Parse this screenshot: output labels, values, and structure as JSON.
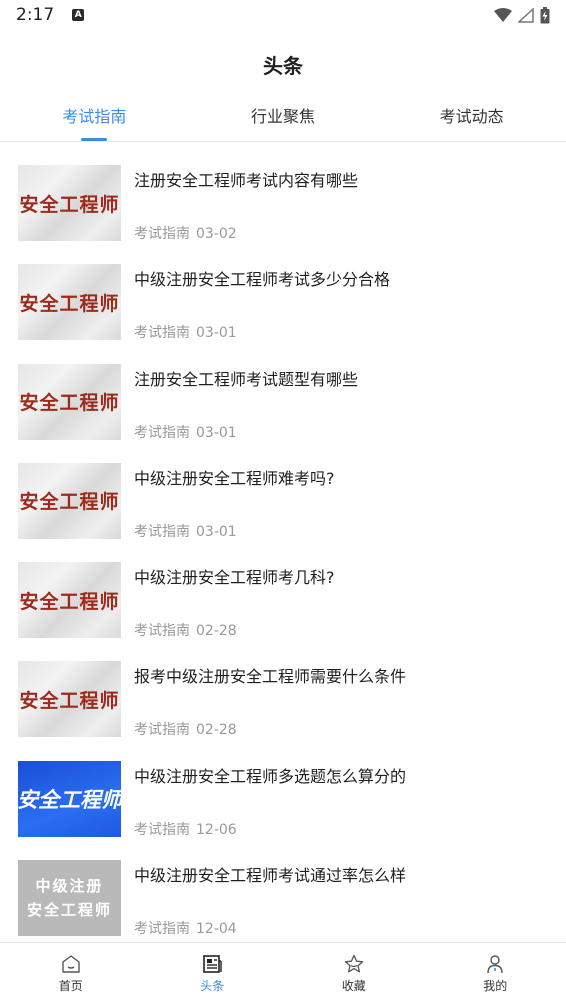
{
  "status_bar": {
    "time": "2:17",
    "icons": [
      "a-notification-icon",
      "wifi-icon",
      "signal-icon",
      "battery-icon"
    ]
  },
  "header": {
    "title": "头条"
  },
  "tabs": [
    {
      "label": "考试指南",
      "active": true
    },
    {
      "label": "行业聚焦",
      "active": false
    },
    {
      "label": "考试动态",
      "active": false
    }
  ],
  "news": [
    {
      "title": "注册安全工程师考试内容有哪些",
      "category": "考试指南",
      "date": "03-02",
      "thumb_style": "paper",
      "thumb_text": "安全工程师"
    },
    {
      "title": "中级注册安全工程师考试多少分合格",
      "category": "考试指南",
      "date": "03-01",
      "thumb_style": "paper",
      "thumb_text": "安全工程师"
    },
    {
      "title": "注册安全工程师考试题型有哪些",
      "category": "考试指南",
      "date": "03-01",
      "thumb_style": "paper",
      "thumb_text": "安全工程师"
    },
    {
      "title": "中级注册安全工程师难考吗?",
      "category": "考试指南",
      "date": "03-01",
      "thumb_style": "paper",
      "thumb_text": "安全工程师"
    },
    {
      "title": "中级注册安全工程师考几科?",
      "category": "考试指南",
      "date": "02-28",
      "thumb_style": "paper",
      "thumb_text": "安全工程师"
    },
    {
      "title": "报考中级注册安全工程师需要什么条件",
      "category": "考试指南",
      "date": "02-28",
      "thumb_style": "paper",
      "thumb_text": "安全工程师"
    },
    {
      "title": "中级注册安全工程师多选题怎么算分的",
      "category": "考试指南",
      "date": "12-06",
      "thumb_style": "blue",
      "thumb_text": "安全工程师"
    },
    {
      "title": "中级注册安全工程师考试通过率怎么样",
      "category": "考试指南",
      "date": "12-04",
      "thumb_style": "gray",
      "thumb_text_lines": [
        "中级注册",
        "安全工程师"
      ]
    }
  ],
  "bottom_nav": [
    {
      "label": "首页",
      "icon": "home-icon",
      "active": false
    },
    {
      "label": "头条",
      "icon": "news-icon",
      "active": true
    },
    {
      "label": "收藏",
      "icon": "star-icon",
      "active": false
    },
    {
      "label": "我的",
      "icon": "profile-icon",
      "active": false
    }
  ],
  "colors": {
    "accent": "#3c8ce7",
    "text": "#1f1f1f",
    "meta": "#9a9a9a",
    "thumb_red_text": "#9e2a1c",
    "thumb_blue_bg": "#2a6ef2"
  }
}
